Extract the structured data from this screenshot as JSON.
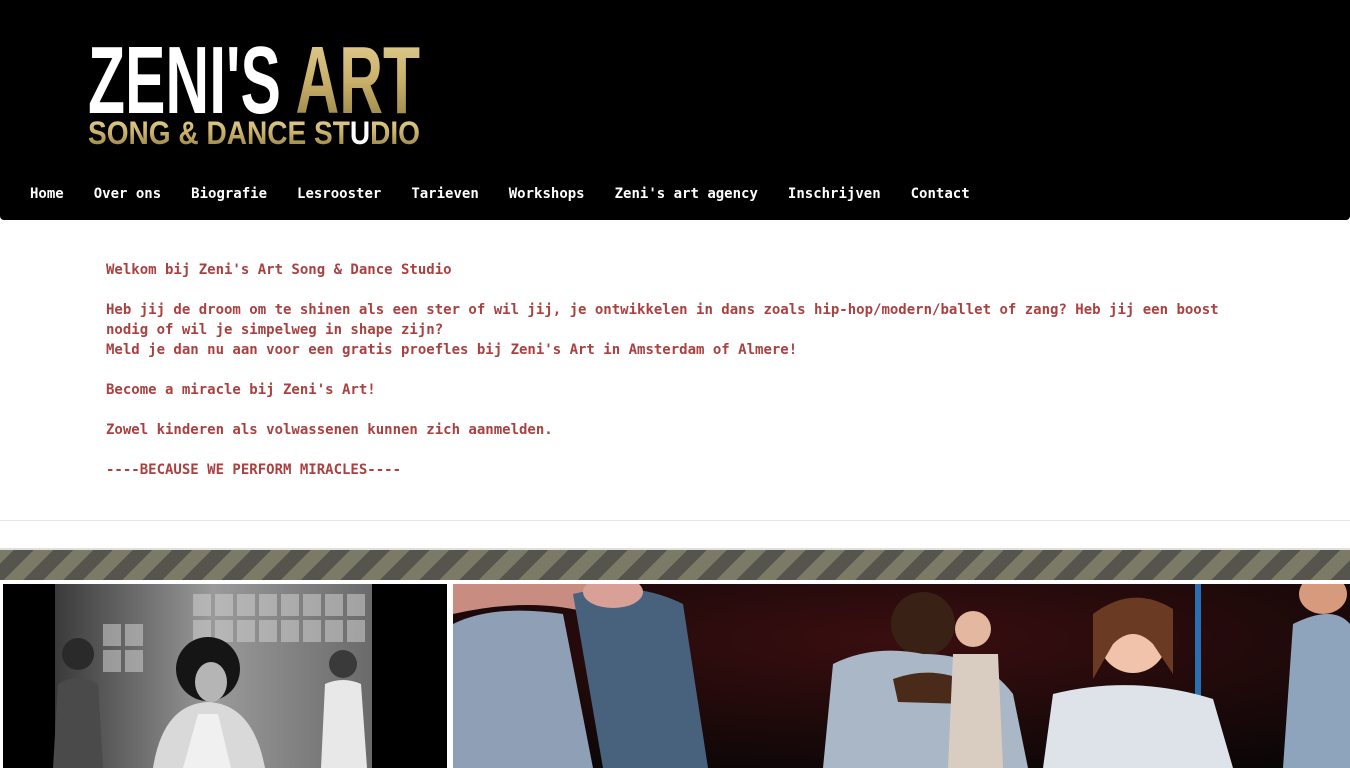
{
  "logo": {
    "line1_white": "ZENI'S ",
    "line1_gold": "ART",
    "line2_part1": "SONG & DANCE ST",
    "line2_gold": "U",
    "line2_part2": "DIO",
    "colors": {
      "gold": "#c9b06a",
      "white": "#ffffff"
    }
  },
  "nav": {
    "items": [
      {
        "label": "Home"
      },
      {
        "label": "Over ons"
      },
      {
        "label": "Biografie"
      },
      {
        "label": "Lesrooster"
      },
      {
        "label": "Tarieven"
      },
      {
        "label": "Workshops"
      },
      {
        "label": "Zeni's art agency"
      },
      {
        "label": "Inschrijven"
      },
      {
        "label": "Contact"
      }
    ]
  },
  "content": {
    "welcome": "Welkom bij Zeni's Art Song & Dance Studio",
    "intro": "Heb jij de droom om te shinen als een ster of wil jij, je ontwikkelen in dans zoals hip-hop/modern/ballet of zang? Heb jij een boost nodig of wil je simpelweg in shape zijn?\nMeld je dan nu aan voor een gratis proefles bij Zeni's Art in Amsterdam of Almere!",
    "miracle": "Become a miracle bij Zeni's Art!",
    "audience": "Zowel kinderen als volwassenen kunnen zich aanmelden.",
    "slogan": "----BECAUSE WE PERFORM MIRACLES----"
  },
  "colors": {
    "header_bg": "#000000",
    "text_accent": "#a8413f",
    "stripe_dark": "#55554e",
    "stripe_light": "#7a7a67"
  },
  "images": {
    "left": "black-and-white dance class photo",
    "right": "children dancing on stage photo"
  }
}
